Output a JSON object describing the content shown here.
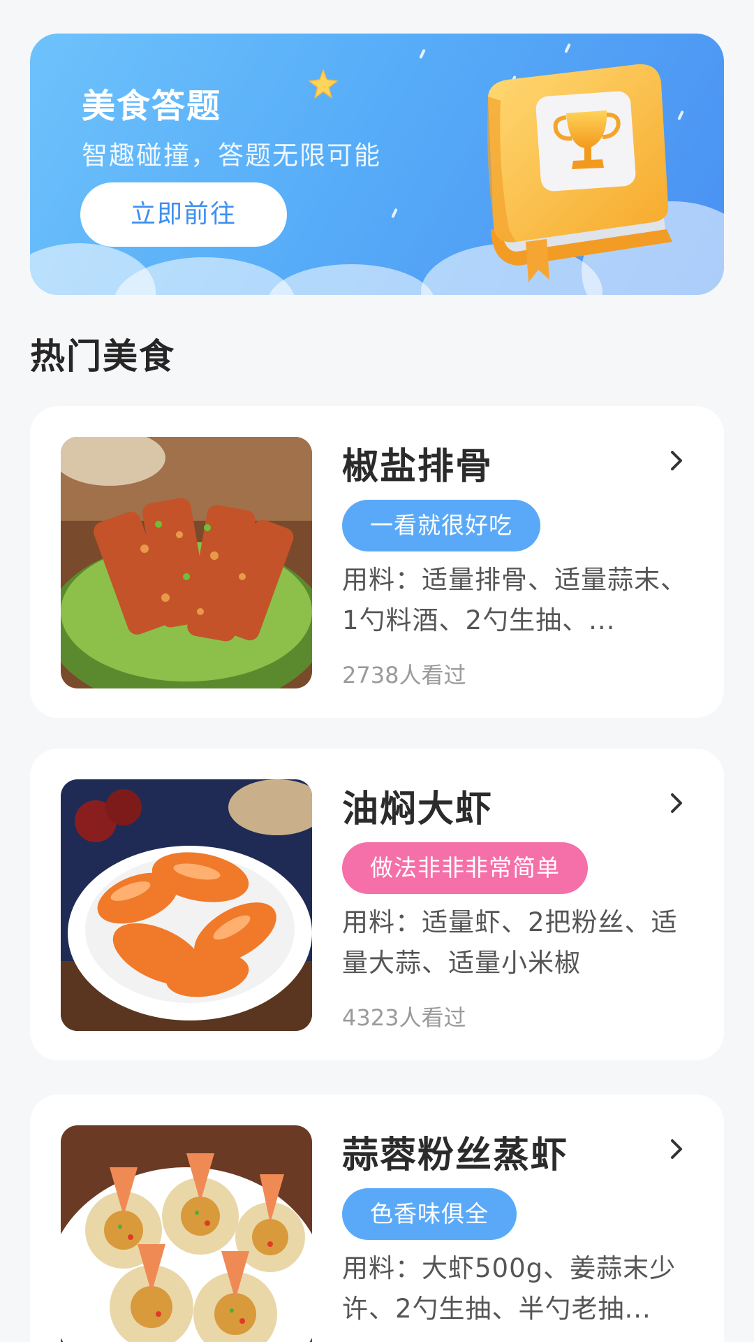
{
  "banner": {
    "title": "美食答题",
    "subtitle": "智趣碰撞，答题无限可能",
    "button_label": "立即前往"
  },
  "section": {
    "title": "热门美食"
  },
  "colors": {
    "tag_blue": "#5aa9f9",
    "tag_pink": "#f56fa8",
    "banner_blue": "#57adf8",
    "book_yellow": "#f7b93c"
  },
  "foods": [
    {
      "name": "椒盐排骨",
      "tag": "一看就很好吃",
      "tag_color": "#5aa9f9",
      "ingredients": "用料：适量排骨、适量蒜末、1勺料酒、2勺生抽、...",
      "views": "2738人看过",
      "image": "salt-pepper-ribs-photo"
    },
    {
      "name": "油焖大虾",
      "tag": "做法非非非常简单",
      "tag_color": "#f56fa8",
      "ingredients": "用料：适量虾、2把粉丝、适量大蒜、适量小米椒",
      "views": "4323人看过",
      "image": "braised-shrimp-photo"
    },
    {
      "name": "蒜蓉粉丝蒸虾",
      "tag": "色香味俱全",
      "tag_color": "#5aa9f9",
      "ingredients": "用料：大虾500g、姜蒜末少许、2勺生抽、半勺老抽...",
      "views": "",
      "image": "garlic-vermicelli-shrimp-photo"
    }
  ]
}
